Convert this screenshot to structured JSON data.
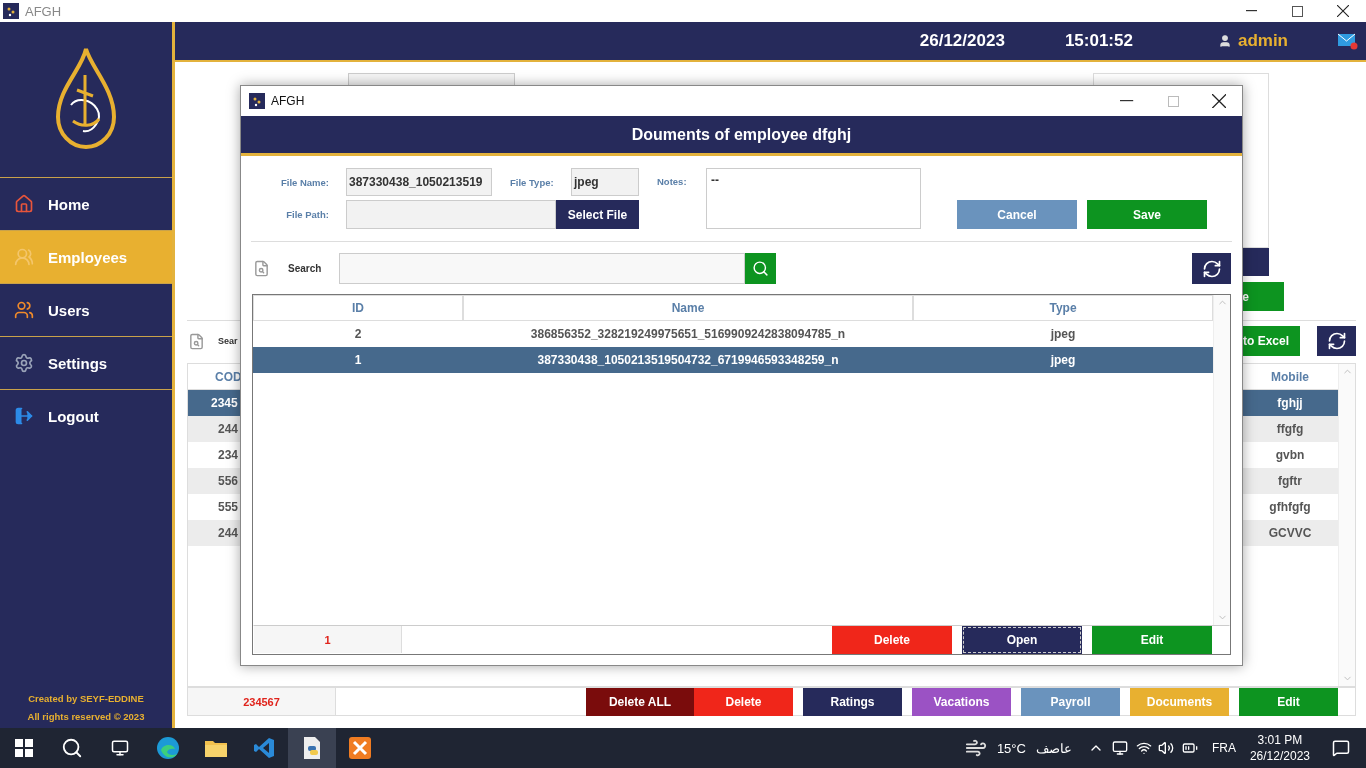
{
  "window": {
    "title": "AFGH"
  },
  "header": {
    "date": "26/12/2023",
    "time": "15:01:52",
    "user": "admin"
  },
  "sidebar": {
    "items": [
      {
        "label": "Home",
        "selected": false
      },
      {
        "label": "Employees",
        "selected": true
      },
      {
        "label": "Users",
        "selected": false
      },
      {
        "label": "Settings",
        "selected": false
      },
      {
        "label": "Logout",
        "selected": false
      }
    ],
    "credits": [
      "Created by SEYF-EDDINE",
      "All rights reserved © 2023"
    ]
  },
  "employees": {
    "side_button": "e",
    "search_label": "Sear",
    "export_button": "to Excel",
    "table": {
      "columns": [
        "COD",
        "Mobile"
      ],
      "rows": [
        {
          "code": "2345",
          "mobile": "fghjj",
          "selected": true
        },
        {
          "code": "244",
          "mobile": "ffgfg",
          "selected": false
        },
        {
          "code": "234",
          "mobile": "gvbn",
          "selected": false
        },
        {
          "code": "556",
          "mobile": "fgftr",
          "selected": false
        },
        {
          "code": "555",
          "mobile": "gfhfgfg",
          "selected": false
        },
        {
          "code": "244",
          "mobile": "GCVVC",
          "selected": false
        }
      ]
    },
    "count": "234567",
    "actions": [
      {
        "label": "Delete ALL",
        "color": "#7a0c0c"
      },
      {
        "label": "Delete",
        "color": "#f0261a"
      },
      {
        "label": "Ratings",
        "color": "#262a5b"
      },
      {
        "label": "Vacations",
        "color": "#9b52c4"
      },
      {
        "label": "Payroll",
        "color": "#6a93bd"
      },
      {
        "label": "Documents",
        "color": "#e8b030"
      },
      {
        "label": "Edit",
        "color": "#0d9420"
      }
    ]
  },
  "dialog": {
    "title": "AFGH",
    "heading": "Douments of employee dfghj",
    "form": {
      "file_name_label": "File Name:",
      "file_name": "387330438_1050213519",
      "file_type_label": "File Type:",
      "file_type": "jpeg",
      "notes_label": "Notes:",
      "notes": "--",
      "file_path_label": "File Path:",
      "select_button": "Select File",
      "cancel_button": "Cancel",
      "save_button": "Save"
    },
    "search_label": "Search",
    "table": {
      "columns": [
        "ID",
        "Name",
        "Type"
      ],
      "rows": [
        {
          "id": "2",
          "name": "386856352_328219249975651_5169909242838094785_n",
          "type": "jpeg",
          "selected": false
        },
        {
          "id": "1",
          "name": "387330438_1050213519504732_6719946593348259_n",
          "type": "jpeg",
          "selected": true
        }
      ]
    },
    "count": "1",
    "actions": [
      {
        "label": "Delete",
        "color": "#f0261a",
        "focused": false
      },
      {
        "label": "Open",
        "color": "#262a5b",
        "focused": true
      },
      {
        "label": "Edit",
        "color": "#0d9420",
        "focused": false
      }
    ]
  },
  "taskbar": {
    "apps": [
      {
        "selected": false
      },
      {
        "selected": false
      },
      {
        "selected": false
      },
      {
        "selected": true
      },
      {
        "selected": false
      }
    ],
    "temperature": "15°C",
    "weather": "عاصف",
    "language": "FRA",
    "time": "3:01 PM",
    "date": "26/12/2023"
  }
}
